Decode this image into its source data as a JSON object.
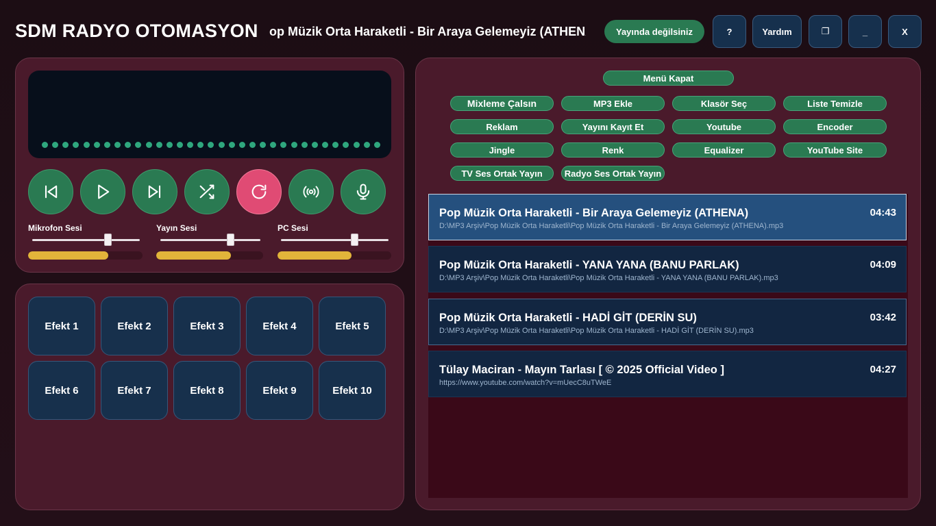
{
  "header": {
    "app_title": "SDM RADYO OTOMASYON",
    "now_playing_marquee": "Pop Müzik Orta Haraketli - Bir Araya Gelemeyiz (ATHENA)",
    "status": "Yayında değilsiniz",
    "buttons": {
      "help_q": "?",
      "help": "Yardım",
      "maximize": "❐",
      "minimize": "_",
      "close": "X"
    }
  },
  "player": {
    "controls": [
      {
        "name": "previous",
        "icon": "skip-back-icon"
      },
      {
        "name": "play",
        "icon": "play-icon"
      },
      {
        "name": "next",
        "icon": "skip-forward-icon"
      },
      {
        "name": "shuffle",
        "icon": "shuffle-icon"
      },
      {
        "name": "repeat",
        "icon": "repeat-icon",
        "active": true
      },
      {
        "name": "broadcast",
        "icon": "broadcast-icon"
      },
      {
        "name": "microphone",
        "icon": "microphone-icon"
      }
    ],
    "sliders": [
      {
        "label": "Mikrofon Sesi",
        "value": 0.7,
        "level": 0.7
      },
      {
        "label": "Yayın Sesi",
        "value": 0.7,
        "level": 0.7
      },
      {
        "label": "PC Sesi",
        "value": 0.68,
        "level": 0.65
      }
    ]
  },
  "effects": [
    "Efekt 1",
    "Efekt 2",
    "Efekt 3",
    "Efekt 4",
    "Efekt 5",
    "Efekt 6",
    "Efekt 7",
    "Efekt 8",
    "Efekt 9",
    "Efekt 10"
  ],
  "menu": {
    "close_menu": "Menü Kapat",
    "items": [
      "Mixleme Çalsın",
      "MP3 Ekle",
      "Klasör Seç",
      "Liste Temizle",
      "Reklam",
      "Yayını Kayıt Et",
      "Youtube",
      "Encoder",
      "Jingle",
      "Renk",
      "Equalizer",
      "YouTube Site",
      "TV Ses Ortak Yayın",
      "Radyo Ses Ortak Yayın"
    ]
  },
  "playlist": [
    {
      "title": "Pop Müzik Orta Haraketli - Bir Araya Gelemeyiz (ATHENA)",
      "path": "D:\\MP3 Arşiv\\Pop Müzik Orta Haraketli\\Pop Müzik Orta Haraketli - Bir Araya Gelemeyiz (ATHENA).mp3",
      "duration": "04:43",
      "selected": true
    },
    {
      "title": "Pop Müzik Orta Haraketli - YANA YANA (BANU PARLAK)",
      "path": "D:\\MP3 Arşiv\\Pop Müzik Orta Haraketli\\Pop Müzik Orta Haraketli - YANA YANA (BANU PARLAK).mp3",
      "duration": "04:09",
      "selected": false
    },
    {
      "title": "Pop Müzik Orta Haraketli - HADİ GİT (DERİN SU)",
      "path": "D:\\MP3 Arşiv\\Pop Müzik Orta Haraketli\\Pop Müzik Orta Haraketli - HADİ GİT (DERİN SU).mp3",
      "duration": "03:42",
      "selected": false
    },
    {
      "title": "Tülay Maciran - Mayın Tarlası [ © 2025 Official Video ]",
      "path": "https://www.youtube.com/watch?v=mUecC8uTWeE",
      "duration": "04:27",
      "selected": false
    }
  ],
  "colors": {
    "accent_green": "#2a7a52",
    "active_pink": "#e04b74",
    "panel": "#4a1a2b",
    "track": "#122641",
    "track_selected": "#25507e",
    "level": "#e2b43a"
  }
}
